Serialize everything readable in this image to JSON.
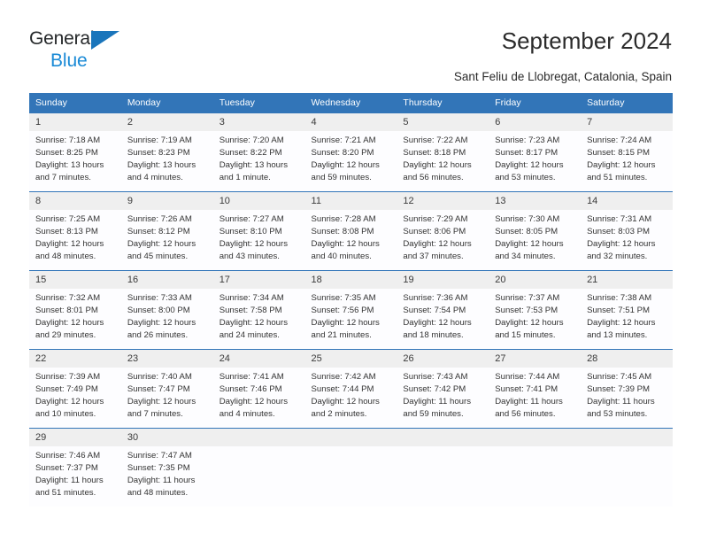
{
  "brand": {
    "name_line1": "General",
    "name_line2": "Blue",
    "accent_dark": "#1a75bb",
    "accent_light": "#1a8ad6"
  },
  "header": {
    "title": "September 2024",
    "subtitle": "Sant Feliu de Llobregat, Catalonia, Spain"
  },
  "theme": {
    "header_blue": "#3275b8",
    "daynum_gray": "#efefef",
    "text": "#333333"
  },
  "calendar": {
    "weekday_headers": [
      "Sunday",
      "Monday",
      "Tuesday",
      "Wednesday",
      "Thursday",
      "Friday",
      "Saturday"
    ],
    "weeks": [
      [
        {
          "day": "1",
          "sunrise": "Sunrise: 7:18 AM",
          "sunset": "Sunset: 8:25 PM",
          "daylight_line1": "Daylight: 13 hours",
          "daylight_line2": "and 7 minutes."
        },
        {
          "day": "2",
          "sunrise": "Sunrise: 7:19 AM",
          "sunset": "Sunset: 8:23 PM",
          "daylight_line1": "Daylight: 13 hours",
          "daylight_line2": "and 4 minutes."
        },
        {
          "day": "3",
          "sunrise": "Sunrise: 7:20 AM",
          "sunset": "Sunset: 8:22 PM",
          "daylight_line1": "Daylight: 13 hours",
          "daylight_line2": "and 1 minute."
        },
        {
          "day": "4",
          "sunrise": "Sunrise: 7:21 AM",
          "sunset": "Sunset: 8:20 PM",
          "daylight_line1": "Daylight: 12 hours",
          "daylight_line2": "and 59 minutes."
        },
        {
          "day": "5",
          "sunrise": "Sunrise: 7:22 AM",
          "sunset": "Sunset: 8:18 PM",
          "daylight_line1": "Daylight: 12 hours",
          "daylight_line2": "and 56 minutes."
        },
        {
          "day": "6",
          "sunrise": "Sunrise: 7:23 AM",
          "sunset": "Sunset: 8:17 PM",
          "daylight_line1": "Daylight: 12 hours",
          "daylight_line2": "and 53 minutes."
        },
        {
          "day": "7",
          "sunrise": "Sunrise: 7:24 AM",
          "sunset": "Sunset: 8:15 PM",
          "daylight_line1": "Daylight: 12 hours",
          "daylight_line2": "and 51 minutes."
        }
      ],
      [
        {
          "day": "8",
          "sunrise": "Sunrise: 7:25 AM",
          "sunset": "Sunset: 8:13 PM",
          "daylight_line1": "Daylight: 12 hours",
          "daylight_line2": "and 48 minutes."
        },
        {
          "day": "9",
          "sunrise": "Sunrise: 7:26 AM",
          "sunset": "Sunset: 8:12 PM",
          "daylight_line1": "Daylight: 12 hours",
          "daylight_line2": "and 45 minutes."
        },
        {
          "day": "10",
          "sunrise": "Sunrise: 7:27 AM",
          "sunset": "Sunset: 8:10 PM",
          "daylight_line1": "Daylight: 12 hours",
          "daylight_line2": "and 43 minutes."
        },
        {
          "day": "11",
          "sunrise": "Sunrise: 7:28 AM",
          "sunset": "Sunset: 8:08 PM",
          "daylight_line1": "Daylight: 12 hours",
          "daylight_line2": "and 40 minutes."
        },
        {
          "day": "12",
          "sunrise": "Sunrise: 7:29 AM",
          "sunset": "Sunset: 8:06 PM",
          "daylight_line1": "Daylight: 12 hours",
          "daylight_line2": "and 37 minutes."
        },
        {
          "day": "13",
          "sunrise": "Sunrise: 7:30 AM",
          "sunset": "Sunset: 8:05 PM",
          "daylight_line1": "Daylight: 12 hours",
          "daylight_line2": "and 34 minutes."
        },
        {
          "day": "14",
          "sunrise": "Sunrise: 7:31 AM",
          "sunset": "Sunset: 8:03 PM",
          "daylight_line1": "Daylight: 12 hours",
          "daylight_line2": "and 32 minutes."
        }
      ],
      [
        {
          "day": "15",
          "sunrise": "Sunrise: 7:32 AM",
          "sunset": "Sunset: 8:01 PM",
          "daylight_line1": "Daylight: 12 hours",
          "daylight_line2": "and 29 minutes."
        },
        {
          "day": "16",
          "sunrise": "Sunrise: 7:33 AM",
          "sunset": "Sunset: 8:00 PM",
          "daylight_line1": "Daylight: 12 hours",
          "daylight_line2": "and 26 minutes."
        },
        {
          "day": "17",
          "sunrise": "Sunrise: 7:34 AM",
          "sunset": "Sunset: 7:58 PM",
          "daylight_line1": "Daylight: 12 hours",
          "daylight_line2": "and 24 minutes."
        },
        {
          "day": "18",
          "sunrise": "Sunrise: 7:35 AM",
          "sunset": "Sunset: 7:56 PM",
          "daylight_line1": "Daylight: 12 hours",
          "daylight_line2": "and 21 minutes."
        },
        {
          "day": "19",
          "sunrise": "Sunrise: 7:36 AM",
          "sunset": "Sunset: 7:54 PM",
          "daylight_line1": "Daylight: 12 hours",
          "daylight_line2": "and 18 minutes."
        },
        {
          "day": "20",
          "sunrise": "Sunrise: 7:37 AM",
          "sunset": "Sunset: 7:53 PM",
          "daylight_line1": "Daylight: 12 hours",
          "daylight_line2": "and 15 minutes."
        },
        {
          "day": "21",
          "sunrise": "Sunrise: 7:38 AM",
          "sunset": "Sunset: 7:51 PM",
          "daylight_line1": "Daylight: 12 hours",
          "daylight_line2": "and 13 minutes."
        }
      ],
      [
        {
          "day": "22",
          "sunrise": "Sunrise: 7:39 AM",
          "sunset": "Sunset: 7:49 PM",
          "daylight_line1": "Daylight: 12 hours",
          "daylight_line2": "and 10 minutes."
        },
        {
          "day": "23",
          "sunrise": "Sunrise: 7:40 AM",
          "sunset": "Sunset: 7:47 PM",
          "daylight_line1": "Daylight: 12 hours",
          "daylight_line2": "and 7 minutes."
        },
        {
          "day": "24",
          "sunrise": "Sunrise: 7:41 AM",
          "sunset": "Sunset: 7:46 PM",
          "daylight_line1": "Daylight: 12 hours",
          "daylight_line2": "and 4 minutes."
        },
        {
          "day": "25",
          "sunrise": "Sunrise: 7:42 AM",
          "sunset": "Sunset: 7:44 PM",
          "daylight_line1": "Daylight: 12 hours",
          "daylight_line2": "and 2 minutes."
        },
        {
          "day": "26",
          "sunrise": "Sunrise: 7:43 AM",
          "sunset": "Sunset: 7:42 PM",
          "daylight_line1": "Daylight: 11 hours",
          "daylight_line2": "and 59 minutes."
        },
        {
          "day": "27",
          "sunrise": "Sunrise: 7:44 AM",
          "sunset": "Sunset: 7:41 PM",
          "daylight_line1": "Daylight: 11 hours",
          "daylight_line2": "and 56 minutes."
        },
        {
          "day": "28",
          "sunrise": "Sunrise: 7:45 AM",
          "sunset": "Sunset: 7:39 PM",
          "daylight_line1": "Daylight: 11 hours",
          "daylight_line2": "and 53 minutes."
        }
      ],
      [
        {
          "day": "29",
          "sunrise": "Sunrise: 7:46 AM",
          "sunset": "Sunset: 7:37 PM",
          "daylight_line1": "Daylight: 11 hours",
          "daylight_line2": "and 51 minutes."
        },
        {
          "day": "30",
          "sunrise": "Sunrise: 7:47 AM",
          "sunset": "Sunset: 7:35 PM",
          "daylight_line1": "Daylight: 11 hours",
          "daylight_line2": "and 48 minutes."
        },
        {
          "day": "",
          "sunrise": "",
          "sunset": "",
          "daylight_line1": "",
          "daylight_line2": ""
        },
        {
          "day": "",
          "sunrise": "",
          "sunset": "",
          "daylight_line1": "",
          "daylight_line2": ""
        },
        {
          "day": "",
          "sunrise": "",
          "sunset": "",
          "daylight_line1": "",
          "daylight_line2": ""
        },
        {
          "day": "",
          "sunrise": "",
          "sunset": "",
          "daylight_line1": "",
          "daylight_line2": ""
        },
        {
          "day": "",
          "sunrise": "",
          "sunset": "",
          "daylight_line1": "",
          "daylight_line2": ""
        }
      ]
    ]
  }
}
